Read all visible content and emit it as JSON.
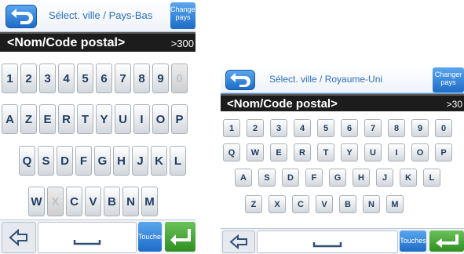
{
  "screen_a": {
    "title": "Sélect. ville / Pays-Bas",
    "change_country": "Changer pays",
    "input_value": "<Nom/Code postal>",
    "result_count": ">300",
    "keys": {
      "row1": [
        "1",
        "2",
        "3",
        "4",
        "5",
        "6",
        "7",
        "8",
        "9",
        "0"
      ],
      "row2": [
        "A",
        "Z",
        "E",
        "R",
        "T",
        "Y",
        "U",
        "I",
        "O",
        "P"
      ],
      "row3": [
        "Q",
        "S",
        "D",
        "F",
        "G",
        "H",
        "J",
        "K",
        "L"
      ],
      "row4": [
        "W",
        "X",
        "C",
        "V",
        "B",
        "N",
        "M"
      ]
    },
    "disabled_keys": [
      "0",
      "X"
    ],
    "keys_button": "Touches"
  },
  "screen_b": {
    "title": "Sélect. ville / Royaume-Uni",
    "change_country": "Changer pays",
    "input_value": "<Nom/Code postal>",
    "result_count": ">30",
    "keys": {
      "row1": [
        "1",
        "2",
        "3",
        "4",
        "5",
        "6",
        "7",
        "8",
        "9",
        "0"
      ],
      "row2": [
        "Q",
        "W",
        "E",
        "R",
        "T",
        "Y",
        "U",
        "I",
        "O",
        "P"
      ],
      "row3": [
        "A",
        "S",
        "D",
        "F",
        "G",
        "H",
        "J",
        "K",
        "L"
      ],
      "row4": [
        "Z",
        "X",
        "C",
        "V",
        "B",
        "N",
        "M"
      ]
    },
    "disabled_keys": [],
    "keys_button": "Touches"
  },
  "icons": [
    "back-arrow-icon",
    "backspace-icon",
    "spacebar-icon",
    "enter-icon"
  ],
  "colors": {
    "accent_blue": "#4a8fd4",
    "title_blue": "#2c6db7",
    "enter_green": "#2e8f22",
    "input_bar": "#1c1c1c"
  }
}
